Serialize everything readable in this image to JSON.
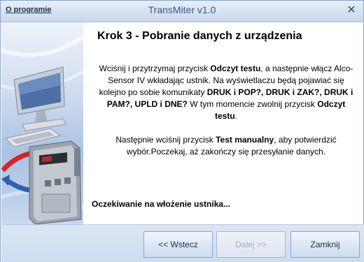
{
  "window": {
    "title": "TransMiter v1.0",
    "about_link": "O programie",
    "close_glyph": "✕"
  },
  "content": {
    "step_title": "Krok 3 - Pobranie danych z urządzenia",
    "paragraph1": {
      "t1": "Wciśnij i przytrzymaj przycisk ",
      "b1": "Odczyt testu",
      "t2": ", a następnie włącz Alco-Sensor IV wkładając ustnik. Na wyświetlaczu będą pojawiać się kolejno po sobie komunikaty ",
      "b2": "DRUK i POP?, DRUK i ZAK?, DRUK i PAM?, UPLD i DNE?",
      "t3": "  W tym momencie zwolnij przycisk ",
      "b3": "Odczyt testu",
      "t4": "."
    },
    "paragraph2": {
      "t1": "Następnie wciśnij przycisk ",
      "b1": "Test manualny",
      "t2": ", aby potwierdzić wybór.Poczekaj, aż zakończy się przesyłanie danych."
    },
    "status_text": "Oczekiwanie na włożenie ustnika..."
  },
  "footer": {
    "back_label": "<< Wstecz",
    "next_label": "Dalej >>",
    "close_label": "Zamknij"
  },
  "colors": {
    "title_text": "#3a5a8a",
    "titlebar": "#d6e2f2",
    "footer": "#cddcf0",
    "arrow_red": "#d6242b",
    "arrow_blue": "#2f5fb4"
  },
  "icons": {
    "side_image": "computer-and-breathalyzer-illustration"
  }
}
